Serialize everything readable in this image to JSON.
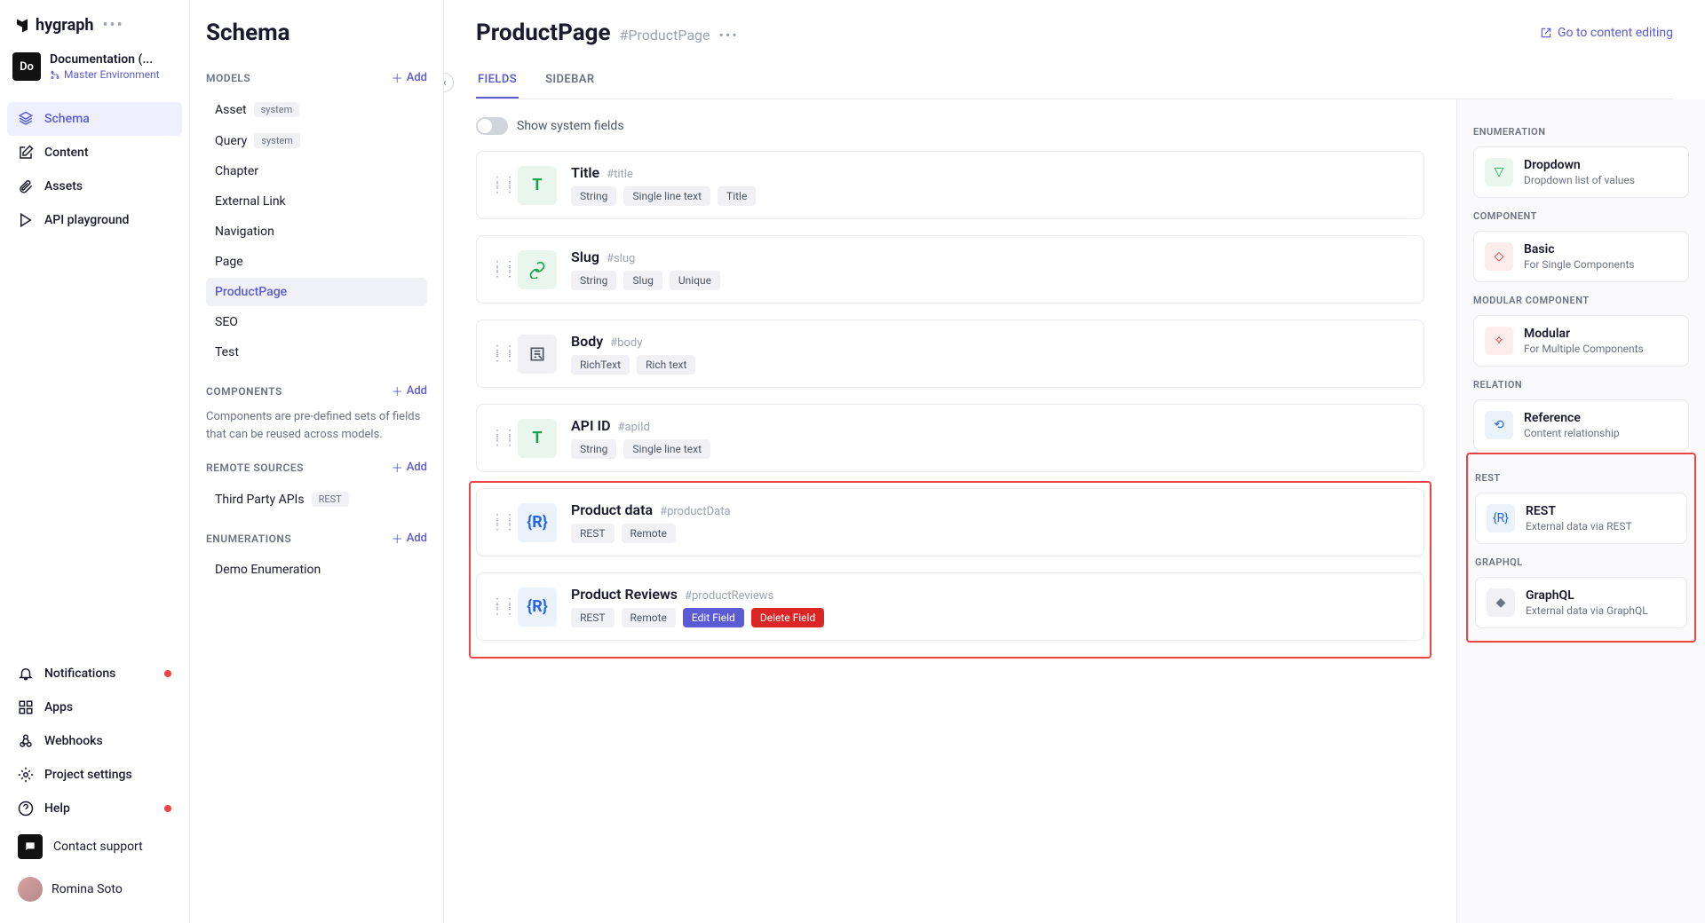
{
  "brand": "hygraph",
  "project": {
    "badge": "Do",
    "name": "Documentation (...",
    "env": "Master Environment"
  },
  "sidebar": {
    "items": [
      {
        "label": "Schema",
        "active": true
      },
      {
        "label": "Content"
      },
      {
        "label": "Assets"
      },
      {
        "label": "API playground"
      }
    ],
    "bottom": [
      {
        "label": "Notifications",
        "dot": true
      },
      {
        "label": "Apps"
      },
      {
        "label": "Webhooks"
      },
      {
        "label": "Project settings"
      },
      {
        "label": "Help",
        "dot": true
      }
    ],
    "support": "Contact support",
    "user": "Romina Soto"
  },
  "schema": {
    "title": "Schema",
    "sections": {
      "models": {
        "label": "MODELS",
        "add": "Add",
        "items": [
          {
            "label": "Asset",
            "badge": "system"
          },
          {
            "label": "Query",
            "badge": "system"
          },
          {
            "label": "Chapter"
          },
          {
            "label": "External Link"
          },
          {
            "label": "Navigation"
          },
          {
            "label": "Page"
          },
          {
            "label": "ProductPage",
            "active": true
          },
          {
            "label": "SEO"
          },
          {
            "label": "Test"
          }
        ]
      },
      "components": {
        "label": "COMPONENTS",
        "add": "Add",
        "desc": "Components are pre-defined sets of fields that can be reused across models."
      },
      "remote": {
        "label": "REMOTE SOURCES",
        "add": "Add",
        "items": [
          {
            "label": "Third Party APIs",
            "badge": "REST"
          }
        ]
      },
      "enums": {
        "label": "ENUMERATIONS",
        "add": "Add",
        "items": [
          {
            "label": "Demo Enumeration"
          }
        ]
      }
    }
  },
  "main": {
    "title": "ProductPage",
    "api": "#ProductPage",
    "editLink": "Go to content editing",
    "tabs": [
      {
        "label": "FIELDS",
        "active": true
      },
      {
        "label": "SIDEBAR"
      }
    ],
    "toggleLabel": "Show system fields",
    "fields": [
      {
        "name": "Title",
        "api": "#title",
        "tags": [
          "String",
          "Single line text",
          "Title"
        ],
        "icon": "T",
        "iconClass": "ic-green"
      },
      {
        "name": "Slug",
        "api": "#slug",
        "tags": [
          "String",
          "Slug",
          "Unique"
        ],
        "icon": "link",
        "iconClass": "ic-green"
      },
      {
        "name": "Body",
        "api": "#body",
        "tags": [
          "RichText",
          "Rich text"
        ],
        "icon": "edit",
        "iconClass": "ic-gray"
      },
      {
        "name": "API ID",
        "api": "#apiId",
        "tags": [
          "String",
          "Single line text"
        ],
        "icon": "T",
        "iconClass": "ic-green"
      },
      {
        "name": "Product data",
        "api": "#productData",
        "tags": [
          "REST",
          "Remote"
        ],
        "icon": "{R}",
        "iconClass": "ic-blue",
        "highlighted": true
      },
      {
        "name": "Product Reviews",
        "api": "#productReviews",
        "tags": [
          "REST",
          "Remote"
        ],
        "icon": "{R}",
        "iconClass": "ic-blue",
        "highlighted": true,
        "actions": [
          {
            "label": "Edit Field",
            "class": "purple"
          },
          {
            "label": "Delete Field",
            "class": "red"
          }
        ]
      }
    ]
  },
  "rail": {
    "sections": [
      {
        "label": "ENUMERATION",
        "items": [
          {
            "title": "Dropdown",
            "desc": "Dropdown list of values",
            "ic": "ric-green",
            "sym": "▽"
          }
        ]
      },
      {
        "label": "COMPONENT",
        "items": [
          {
            "title": "Basic",
            "desc": "For Single Components",
            "ic": "ric-red",
            "sym": "◇"
          }
        ]
      },
      {
        "label": "MODULAR COMPONENT",
        "items": [
          {
            "title": "Modular",
            "desc": "For Multiple Components",
            "ic": "ric-red",
            "sym": "✧"
          }
        ]
      },
      {
        "label": "RELATION",
        "items": [
          {
            "title": "Reference",
            "desc": "Content relationship",
            "ic": "ric-blue",
            "sym": "⟲"
          }
        ]
      },
      {
        "label": "REST",
        "highlighted": true,
        "items": [
          {
            "title": "REST",
            "desc": "External data via REST",
            "ic": "ric-blue",
            "sym": "{R}"
          }
        ]
      },
      {
        "label": "GRAPHQL",
        "highlighted": true,
        "items": [
          {
            "title": "GraphQL",
            "desc": "External data via GraphQL",
            "ic": "ric-gray",
            "sym": "◆"
          }
        ]
      }
    ]
  }
}
